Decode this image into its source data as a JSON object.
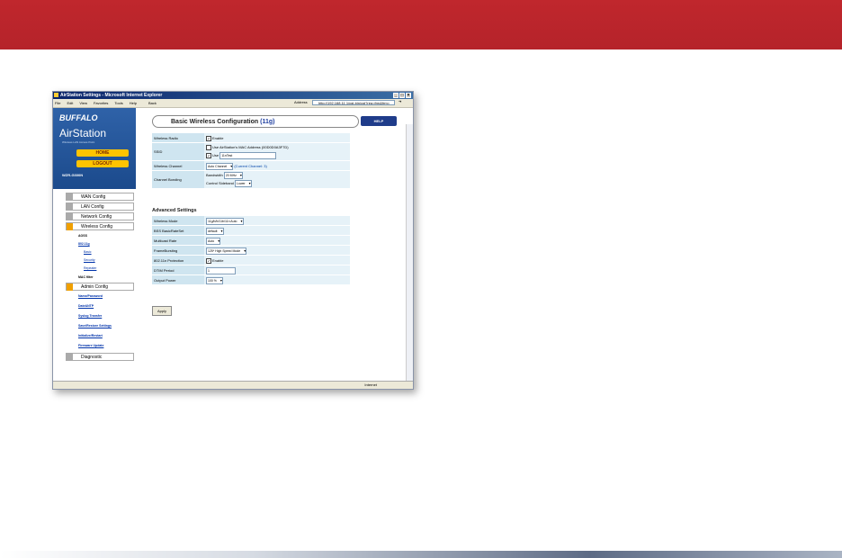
{
  "window": {
    "title": "AirStation Settings - Microsoft Internet Explorer",
    "menu": [
      "File",
      "Edit",
      "View",
      "Favorites",
      "Tools",
      "Help"
    ],
    "back": "Back",
    "address_label": "Address",
    "address": "http://192.168.11.1/cgi-bin/cgi?req=frm&frm=",
    "status": "Internet"
  },
  "sidebar": {
    "brand": "BUFFALO",
    "product": "AirStation",
    "tagline": "Wireless LAN Access Point",
    "home": "HOME",
    "logout": "LOGOUT",
    "model": "WZR-G300N",
    "menus": [
      "WAN Config",
      "LAN Config",
      "Network Config",
      "Wireless Config"
    ],
    "wireless_sub": [
      "AOSS",
      "802.11g",
      "Basic",
      "Security",
      "Repeater",
      "MAC filter"
    ],
    "admin": "Admin Config",
    "admin_sub": [
      "Name/Password",
      "Date&NTP",
      "Syslog Transfer",
      "Save/Restore Settings",
      "Initialize/Restart",
      "Firmware Update"
    ],
    "diagnostic": "Diagnostic"
  },
  "main": {
    "title": "Basic Wireless Configuration",
    "title_suffix": "(11g)",
    "help": "HELP",
    "rows": {
      "radio_label": "Wireless Radio",
      "radio_value": "Enable",
      "ssid_label": "SSID",
      "ssid_opt1": "Use AirStation's MAC Address (00D0D0A3F7D)",
      "ssid_opt2": "Use",
      "ssid_value": "11nTest",
      "channel_label": "Wireless Channel",
      "channel_value": "Auto Channel",
      "channel_note": "(Current Channel: 3)",
      "bonding_label": "Channel Bonding",
      "bandwidth_label": "Bandwidth",
      "bandwidth_value": "20 MHz",
      "extension_label": "Control Sideband",
      "extension_value": "Lower"
    },
    "advanced_title": "Advanced Settings",
    "advanced": {
      "mode_label": "Wireless Mode",
      "mode_value": "11g/b/b/11b/11n Auto",
      "bss_label": "BSS BasicRateSet",
      "bss_value": "default",
      "multicast_label": "Multicast Rate",
      "multicast_value": "Auto",
      "framebursting_label": "FrameBursting",
      "framebursting_value": "125* High Speed Mode",
      "protection_label": "802.11n Protection",
      "protection_value": "Enable",
      "dtim_label": "DTIM Period",
      "dtim_value": "1",
      "power_label": "Output Power",
      "power_value": "100 %"
    },
    "apply": "Apply"
  }
}
